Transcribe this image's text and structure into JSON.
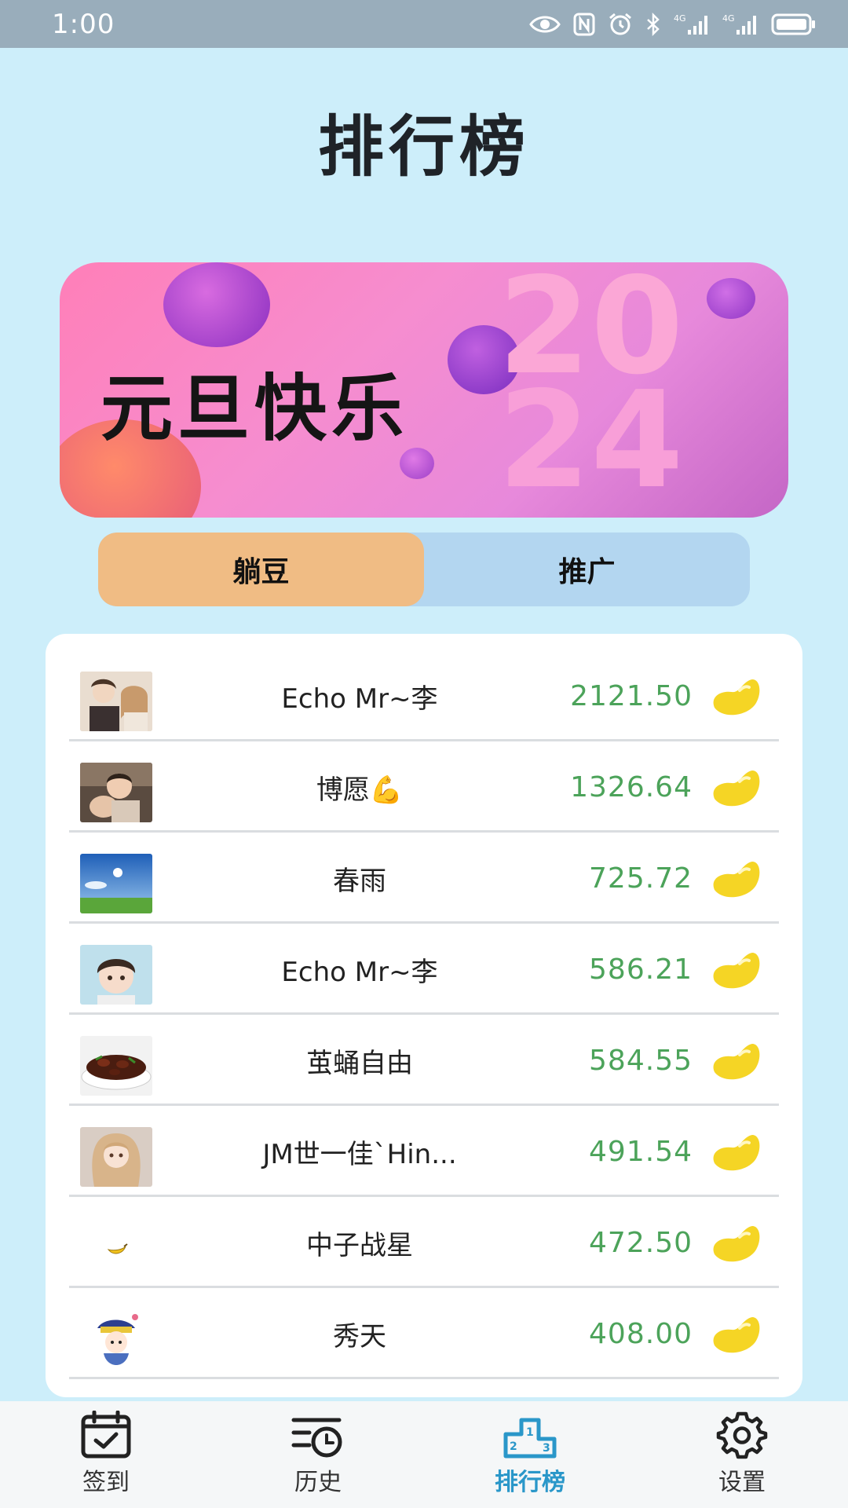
{
  "status_bar": {
    "time": "1:00",
    "icons": [
      "eye-icon",
      "nfc-icon",
      "alarm-icon",
      "bluetooth-icon",
      "signal-4g-icon",
      "signal-4g-icon",
      "battery-icon"
    ],
    "network_label": "4G"
  },
  "page": {
    "title": "排行榜"
  },
  "banner": {
    "text": "元旦快乐",
    "year_top": "20",
    "year_bottom": "24"
  },
  "tabs": [
    {
      "label": "躺豆",
      "active": true
    },
    {
      "label": "推广",
      "active": false
    }
  ],
  "ranking": [
    {
      "name": "Echo Mr~李",
      "score": "2121.50",
      "avatar": "couple-photo"
    },
    {
      "name": "博愿💪",
      "score": "1326.64",
      "avatar": "child-photo"
    },
    {
      "name": "春雨",
      "score": "725.72",
      "avatar": "sky-meadow-photo"
    },
    {
      "name": "Echo Mr~李",
      "score": "586.21",
      "avatar": "anime-boy"
    },
    {
      "name": "茧蛹自由",
      "score": "584.55",
      "avatar": "food-photo"
    },
    {
      "name": "JM世一佳`Hin...",
      "score": "491.54",
      "avatar": "anime-girl"
    },
    {
      "name": "中子战星",
      "score": "472.50",
      "avatar": "banana-emoji"
    },
    {
      "name": "秀天",
      "score": "408.00",
      "avatar": "cartoon-official"
    }
  ],
  "bean_icon": "bean-icon",
  "bottom_nav": [
    {
      "label": "签到",
      "icon": "calendar-check-icon",
      "active": false
    },
    {
      "label": "历史",
      "icon": "history-icon",
      "active": false
    },
    {
      "label": "排行榜",
      "icon": "podium-icon",
      "active": true
    },
    {
      "label": "设置",
      "icon": "gear-icon",
      "active": false
    }
  ],
  "colors": {
    "background": "#cdeefa",
    "status_bar": "#99adbb",
    "tab_active": "#f0bc84",
    "tab_inactive": "#b3d6f0",
    "score": "#4ca35a",
    "bean": "#f5d525",
    "nav_active": "#2a97c9"
  }
}
